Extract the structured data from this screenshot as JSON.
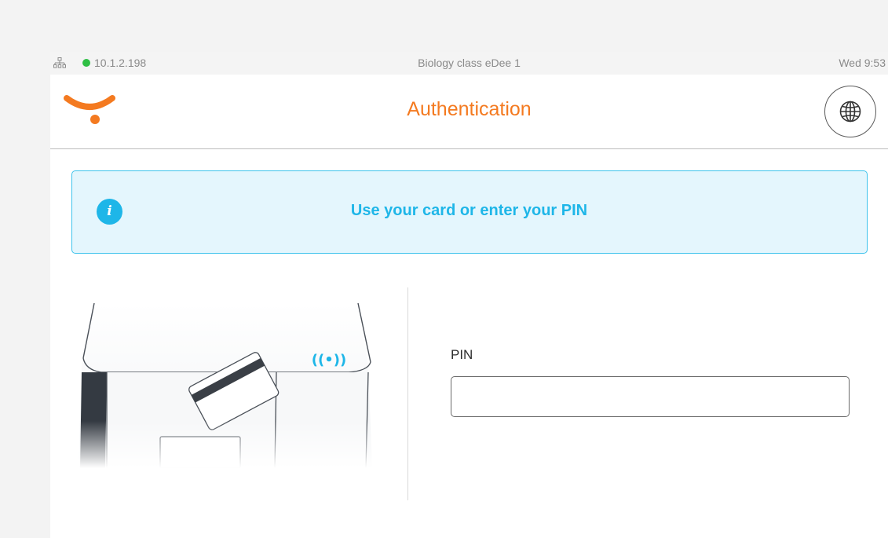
{
  "colors": {
    "brand": "#f47a20",
    "info_accent": "#1eb6e8",
    "info_background": "#e4f6fd",
    "status_online": "#2fbf45"
  },
  "status_bar": {
    "network_icon": "network-icon",
    "connection_status": "online",
    "ip_address": "10.1.2.198",
    "device_name": "Biology class eDee 1",
    "time": "Wed 9:53"
  },
  "header": {
    "logo": "ysoft-logo",
    "title": "Authentication",
    "language_button_icon": "globe-icon"
  },
  "info_banner": {
    "icon": "info-icon",
    "icon_glyph": "i",
    "message": "Use your card or enter your PIN"
  },
  "illustration": {
    "card_icon": "card-reader-illustration",
    "contactless_icon": "contactless-icon",
    "contactless_symbol": "((•))"
  },
  "pin": {
    "label": "PIN",
    "value": "",
    "placeholder": ""
  }
}
